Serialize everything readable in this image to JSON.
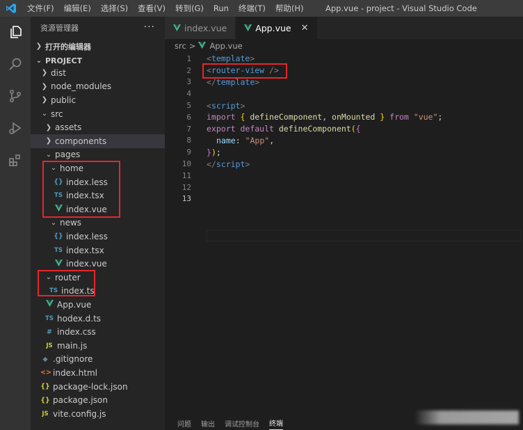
{
  "titlebar": {
    "menu": [
      "文件(F)",
      "编辑(E)",
      "选择(S)",
      "查看(V)",
      "转到(G)",
      "Run",
      "终端(T)",
      "帮助(H)"
    ],
    "window_title": "App.vue - project - Visual Studio Code"
  },
  "activity_bar": [
    "files-icon",
    "search-icon",
    "source-control-icon",
    "run-debug-icon",
    "extensions-icon"
  ],
  "sidebar": {
    "title": "资源管理器",
    "more": "···",
    "open_editors": "打开的编辑器",
    "project": "PROJECT",
    "tree": {
      "dist": "dist",
      "node_modules": "node_modules",
      "public": "public",
      "src": "src",
      "assets": "assets",
      "components": "components",
      "pages": "pages",
      "home": "home",
      "home_less": "index.less",
      "home_tsx": "index.tsx",
      "home_vue": "index.vue",
      "news": "news",
      "news_less": "index.less",
      "news_tsx": "index.tsx",
      "news_vue": "index.vue",
      "router": "router",
      "router_ts": "index.ts",
      "app_vue": "App.vue",
      "hodex_dts": "hodex.d.ts",
      "index_css": "index.css",
      "main_js": "main.js",
      "gitignore": ".gitignore",
      "index_html": "index.html",
      "package_lock": "package-lock.json",
      "package_json": "package.json",
      "vite_config": "vite.config.js"
    },
    "icon_labels": {
      "ts": "TS",
      "js": "JS",
      "json": "{}",
      "less": "{}",
      "css": "#",
      "html": "<>",
      "git": "◆"
    }
  },
  "editor": {
    "tabs": [
      {
        "label": "index.vue",
        "active": false
      },
      {
        "label": "App.vue",
        "active": true
      }
    ],
    "close_glyph": "✕",
    "breadcrumb": {
      "folder": "src",
      "sep": ">",
      "file": "App.vue"
    },
    "line_numbers": [
      "1",
      "2",
      "3",
      "4",
      "5",
      "6",
      "7",
      "8",
      "9",
      "10",
      "11",
      "12",
      "13"
    ],
    "code": {
      "l1": {
        "open": "<",
        "name": "template",
        "close": ">"
      },
      "l2": {
        "open": "<",
        "name": "router-view",
        "close": " />"
      },
      "l3": {
        "open": "</",
        "name": "template",
        "close": ">"
      },
      "l5": {
        "open": "<",
        "name": "script",
        "close": ">"
      },
      "l6": {
        "kw": "import",
        "lb": " { ",
        "fn1": "defineComponent",
        "comma": ", ",
        "fn2": "onMounted",
        "rb": " } ",
        "from": "from",
        "sp": " ",
        "str": "\"vue\"",
        "semi": ";"
      },
      "l7": {
        "kw": "export",
        "kw2": " default ",
        "fn": "defineComponent",
        "p": "(",
        "b": "{"
      },
      "l8": {
        "prop": "name",
        "colon": ": ",
        "str": "\"App\"",
        "comma": ","
      },
      "l9": {
        "b": "}",
        "p": ")",
        "semi": ";"
      },
      "l10": {
        "open": "</",
        "name": "script",
        "close": ">"
      }
    }
  },
  "panel": {
    "tabs": [
      {
        "label": "问题",
        "active": false
      },
      {
        "label": "输出",
        "active": false
      },
      {
        "label": "调试控制台",
        "active": false
      },
      {
        "label": "终端",
        "active": true
      }
    ]
  },
  "colors": {
    "highlight": "#e8262a",
    "vue_green": "#41b883",
    "vscode_blue": "#23a9f2"
  }
}
